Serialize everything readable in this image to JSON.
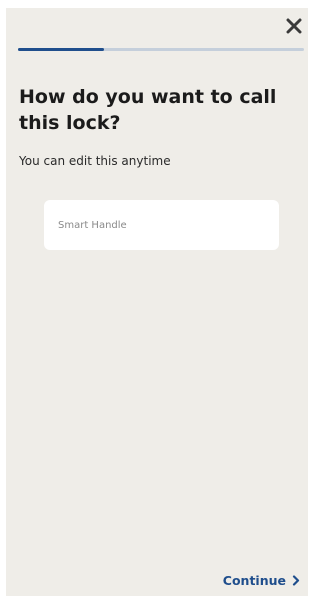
{
  "header": {
    "close_icon": "close-icon",
    "progress_fraction": 0.3
  },
  "main": {
    "title": "How do you want to call this lock?",
    "subtitle": "You can edit this anytime",
    "name_field": {
      "value": "",
      "placeholder": "Smart Handle"
    }
  },
  "footer": {
    "continue_label": "Continue",
    "continue_icon": "chevron-right-icon"
  },
  "colors": {
    "accent": "#1f4e8c",
    "background": "#efede8",
    "progress_track": "#c5cfdb"
  }
}
